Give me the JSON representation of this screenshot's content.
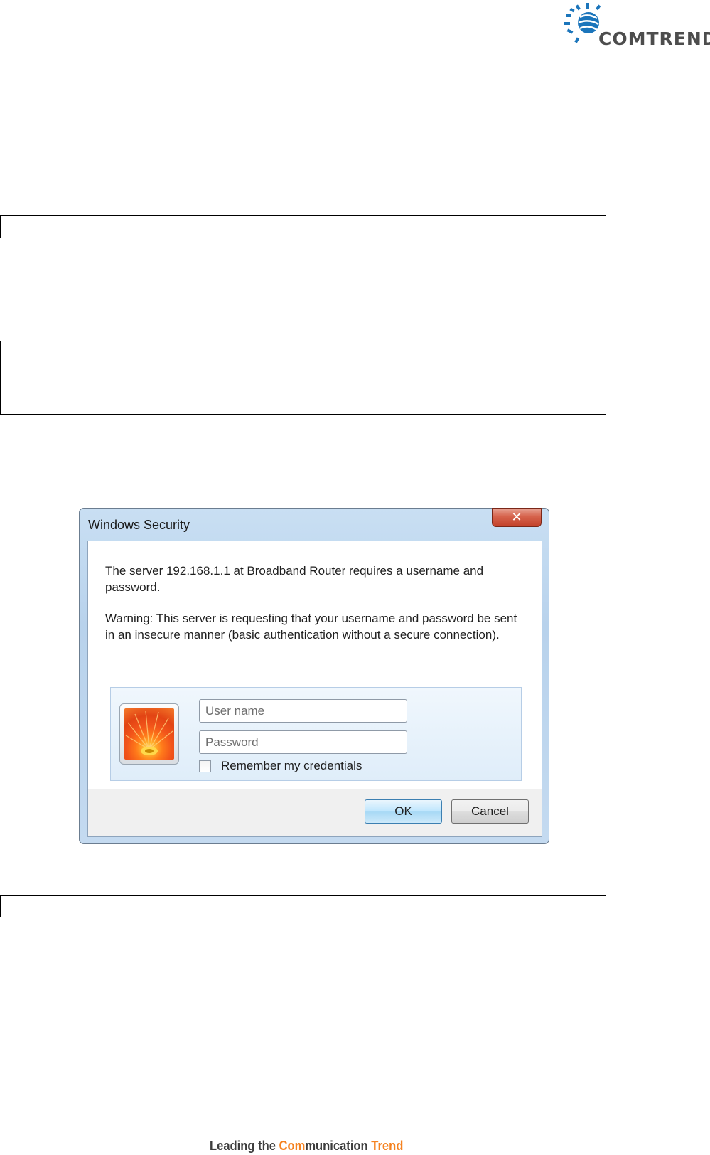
{
  "logo": {
    "text": "COMTREND"
  },
  "dialog": {
    "title": "Windows Security",
    "close_label": "✕",
    "message": "The server 192.168.1.1 at Broadband Router requires a username and password.",
    "warning": "Warning: This server is requesting that your username and password be sent in an insecure manner (basic authentication without a secure connection).",
    "username_placeholder": "User name",
    "password_placeholder": "Password",
    "remember_label": "Remember my credentials",
    "ok_label": "OK",
    "cancel_label": "Cancel"
  },
  "footer": {
    "part1": "Leading the ",
    "part2": "Com",
    "part3": "munication ",
    "part4": "Trend"
  },
  "colors": {
    "accent": "#f58220",
    "logo_blue": "#1b75bb"
  }
}
